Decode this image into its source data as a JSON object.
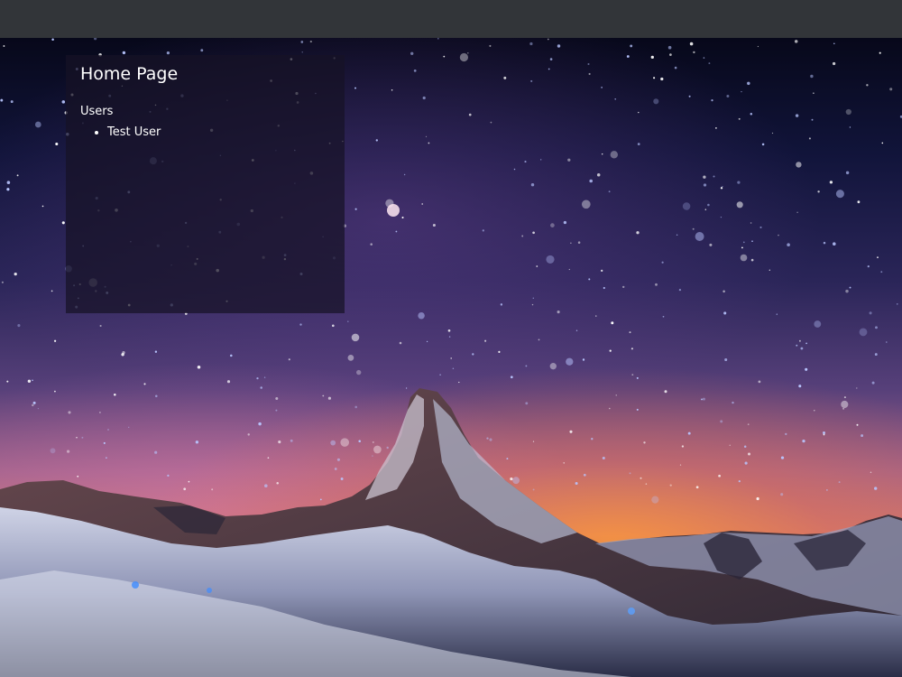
{
  "page": {
    "title": "Home Page"
  },
  "users": {
    "label": "Users",
    "items": [
      {
        "name": "Test User"
      }
    ]
  }
}
